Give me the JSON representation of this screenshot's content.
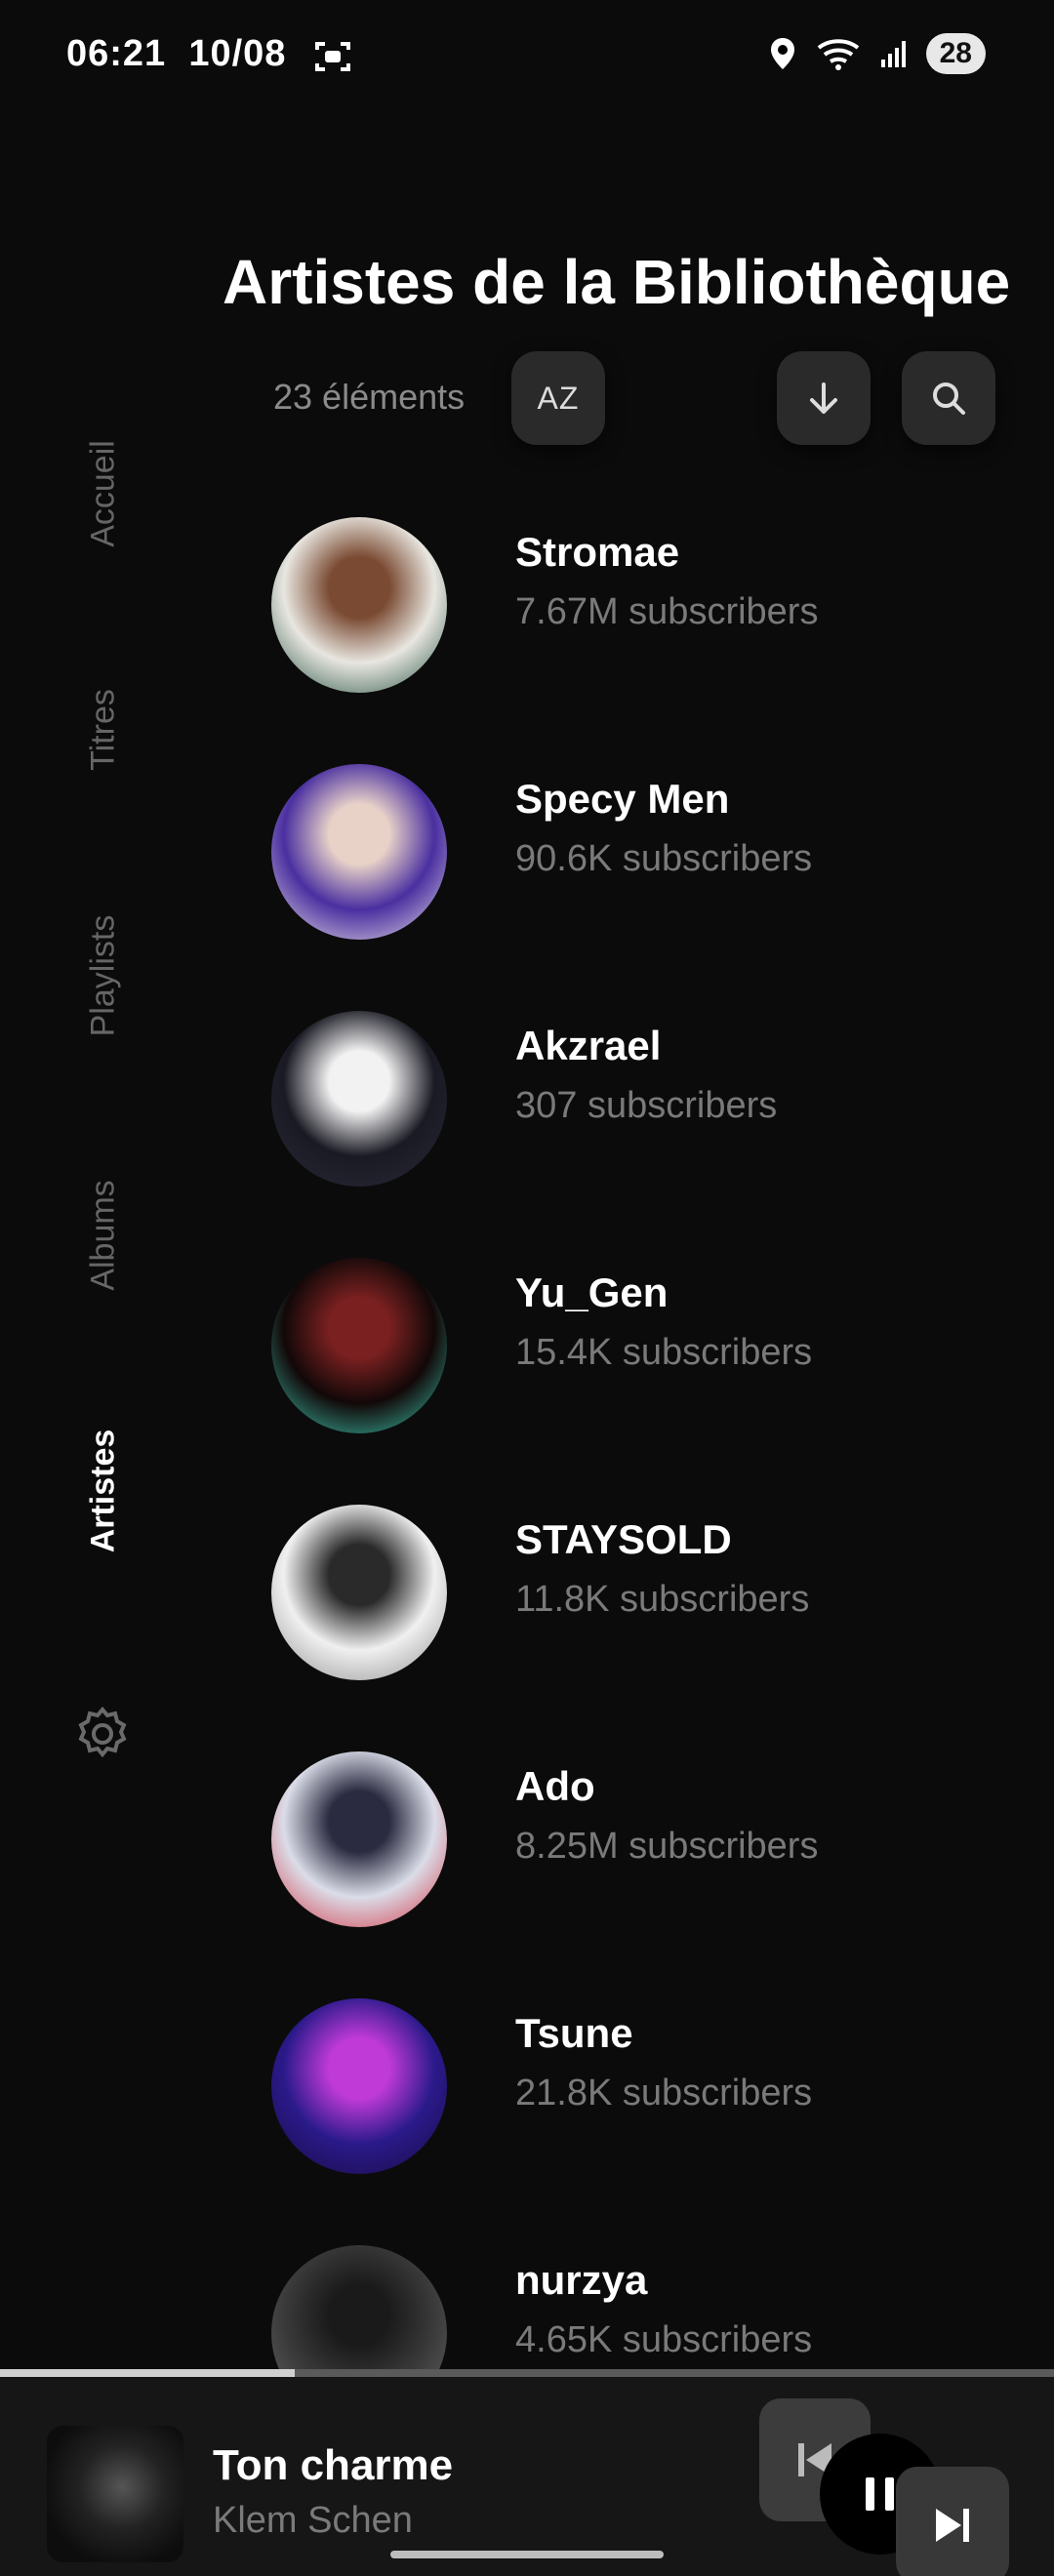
{
  "status_bar": {
    "time": "06:21",
    "date": "10/08",
    "battery": "28"
  },
  "header": {
    "title": "Artistes de la Bibliothèque"
  },
  "toolbar": {
    "count": "23 éléments",
    "sort_label": "AZ"
  },
  "nav": {
    "items": [
      {
        "label": "Accueil",
        "active": false
      },
      {
        "label": "Titres",
        "active": false
      },
      {
        "label": "Playlists",
        "active": false
      },
      {
        "label": "Albums",
        "active": false
      },
      {
        "label": "Artistes",
        "active": true
      }
    ]
  },
  "artists": [
    {
      "name": "Stromae",
      "subscribers": "7.67M subscribers",
      "colors": [
        "#e8e6e0",
        "#7a4a32",
        "#1c4a3a"
      ]
    },
    {
      "name": "Specy Men",
      "subscribers": "90.6K subscribers",
      "colors": [
        "#4a2fa0",
        "#e8d2c8",
        "#f0e8ea"
      ]
    },
    {
      "name": "Akzrael",
      "subscribers": "307 subscribers",
      "colors": [
        "#1a1a24",
        "#f2f2f2",
        "#2a2a38"
      ]
    },
    {
      "name": "Yu_Gen",
      "subscribers": "15.4K subscribers",
      "colors": [
        "#120808",
        "#7a2020",
        "#3fd2b8"
      ]
    },
    {
      "name": "STAYSOLD",
      "subscribers": "11.8K subscribers",
      "colors": [
        "#f0f0f0",
        "#2a2a2a",
        "#8a8a8a"
      ]
    },
    {
      "name": "Ado",
      "subscribers": "8.25M subscribers",
      "colors": [
        "#dadde8",
        "#2a2a40",
        "#d22a3a"
      ]
    },
    {
      "name": "Tsune",
      "subscribers": "21.8K subscribers",
      "colors": [
        "#2a1a8a",
        "#c03ad8",
        "#1a0a40"
      ]
    },
    {
      "name": "nurzya",
      "subscribers": "4.65K subscribers",
      "colors": [
        "#3a3a3a",
        "#1a1a1a",
        "#6a6a6a"
      ]
    }
  ],
  "player": {
    "title": "Ton charme",
    "artist": "Klem Schen",
    "progress": 0.28
  }
}
